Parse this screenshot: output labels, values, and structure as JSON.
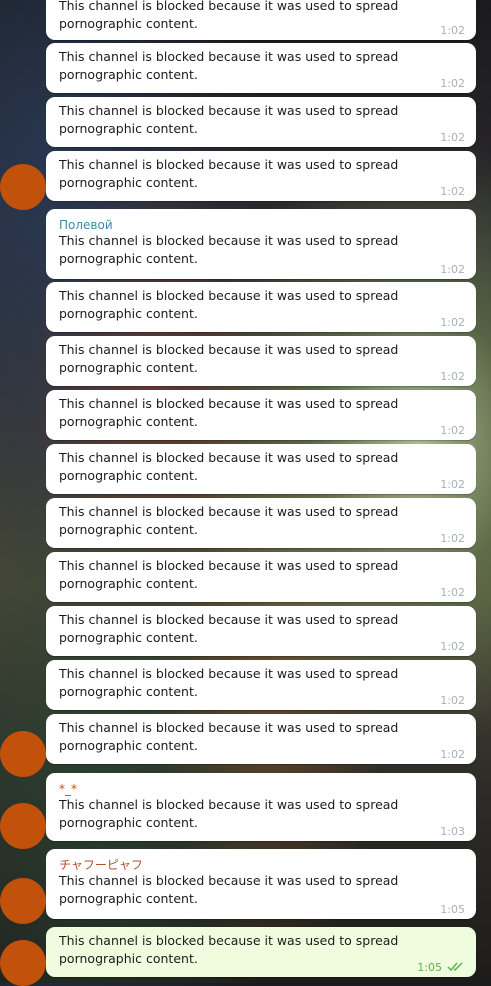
{
  "colors": {
    "bubble_in": "#ffffff",
    "bubble_out": "#effdde",
    "avatar": "#c2510b",
    "sender_polevoy": "#3a8ba8",
    "sender_star": "#c2510b",
    "sender_chahan": "#b54b2c",
    "time_in": "#a7b1b8",
    "time_out": "#5fb14a"
  },
  "chat": {
    "messages": [
      {
        "text": "This channel is blocked because it was used to spread pornographic content.",
        "time": "1:02"
      },
      {
        "text": "This channel is blocked because it was used to spread pornographic content.",
        "time": "1:02"
      },
      {
        "text": "This channel is blocked because it was used to spread pornographic content.",
        "time": "1:02"
      },
      {
        "text": "This channel is blocked because it was used to spread pornographic content.",
        "time": "1:02"
      },
      {
        "sender": "Полевой",
        "text": "This channel is blocked because it was used to spread pornographic content.",
        "time": "1:02"
      },
      {
        "text": "This channel is blocked because it was used to spread pornographic content.",
        "time": "1:02"
      },
      {
        "text": "This channel is blocked because it was used to spread pornographic content.",
        "time": "1:02"
      },
      {
        "text": "This channel is blocked because it was used to spread pornographic content.",
        "time": "1:02"
      },
      {
        "text": "This channel is blocked because it was used to spread pornographic content.",
        "time": "1:02"
      },
      {
        "text": "This channel is blocked because it was used to spread pornographic content.",
        "time": "1:02"
      },
      {
        "text": "This channel is blocked because it was used to spread pornographic content.",
        "time": "1:02"
      },
      {
        "text": "This channel is blocked because it was used to spread pornographic content.",
        "time": "1:02"
      },
      {
        "text": "This channel is blocked because it was used to spread pornographic content.",
        "time": "1:02"
      },
      {
        "text": "This channel is blocked because it was used to spread pornographic content.",
        "time": "1:02"
      },
      {
        "sender": "*_*",
        "text": "This channel is blocked because it was used to spread pornographic content.",
        "time": "1:03"
      },
      {
        "sender": "チャフーピャフ",
        "text": "This channel is blocked because it was used to spread pornographic content.",
        "time": "1:05"
      },
      {
        "text": "This channel is blocked because it was used to spread pornographic content.",
        "time": "1:05",
        "read_icon": "double-check-icon"
      }
    ]
  }
}
